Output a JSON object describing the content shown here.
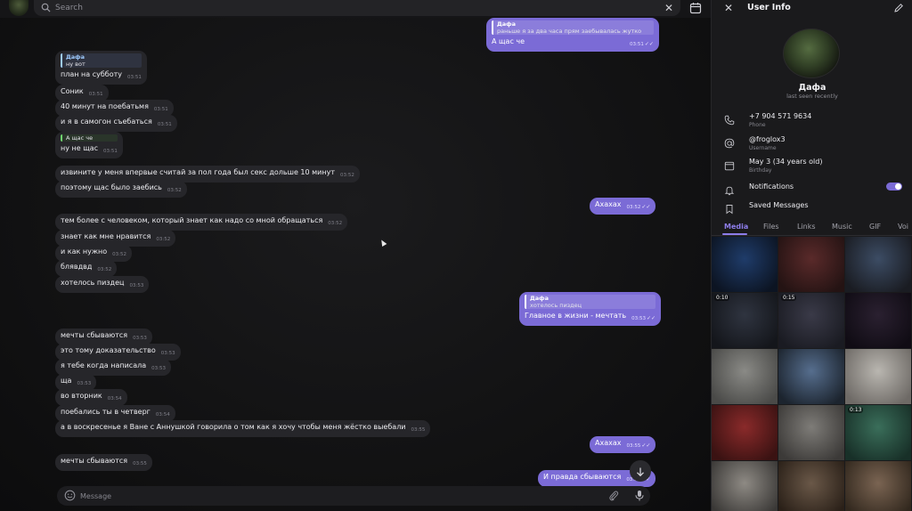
{
  "header": {
    "search_placeholder": "Search"
  },
  "messages": [
    {
      "id": "m0",
      "dir": "out",
      "reply_text": "раньше я за два часа прям заебывалась жутко",
      "reply_name": "Дафа",
      "text": "А щас че",
      "time": "03:51",
      "read": true
    },
    {
      "id": "m1",
      "dir": "in",
      "reply_name": "Дафа",
      "reply_text": "ну вот",
      "text": "план на субботу",
      "time": "03:51"
    },
    {
      "id": "m2",
      "dir": "in",
      "text": "Соник",
      "time": "03:51"
    },
    {
      "id": "m3",
      "dir": "in",
      "text": "40 минут на поебатьмя",
      "time": "03:51"
    },
    {
      "id": "m4",
      "dir": "in",
      "text": "и я в самогон съебаться",
      "time": "03:51"
    },
    {
      "id": "m5",
      "dir": "in",
      "reply_name": "",
      "reply_text": "А щас че",
      "text": "ну не щас",
      "time": "03:51"
    },
    {
      "id": "m6",
      "dir": "in",
      "text": "извините у меня впервые считай за пол года был секс дольше 10 минут",
      "time": "03:52"
    },
    {
      "id": "m7",
      "dir": "in",
      "text": "поэтому щас было заебись",
      "time": "03:52"
    },
    {
      "id": "m8",
      "dir": "out",
      "text": "Ахахах",
      "time": "03:52",
      "read": true
    },
    {
      "id": "m9",
      "dir": "in",
      "text": "тем более с человеком, который знает как надо со мной обращаться",
      "time": "03:52"
    },
    {
      "id": "m10",
      "dir": "in",
      "text": "знает как мне нравится",
      "time": "03:52"
    },
    {
      "id": "m11",
      "dir": "in",
      "text": "и как нужно",
      "time": "03:52"
    },
    {
      "id": "m12",
      "dir": "in",
      "text": "блявдвд",
      "time": "03:52"
    },
    {
      "id": "m13",
      "dir": "in",
      "text": "хотелось пиздец",
      "time": "03:53"
    },
    {
      "id": "m14",
      "dir": "out",
      "reply_name": "Дафа",
      "reply_text": "хотелось пиздец",
      "text": "Главное в жизни - мечтать",
      "time": "03:53",
      "read": true
    },
    {
      "id": "m15",
      "dir": "in",
      "text": "мечты сбываются",
      "time": "03:53"
    },
    {
      "id": "m16",
      "dir": "in",
      "text": "это тому доказательство",
      "time": "03:53"
    },
    {
      "id": "m17",
      "dir": "in",
      "text": "я тебе когда написала",
      "time": "03:53"
    },
    {
      "id": "m18",
      "dir": "in",
      "text": "ща",
      "time": "03:53"
    },
    {
      "id": "m19",
      "dir": "in",
      "text": "во вторник",
      "time": "03:54"
    },
    {
      "id": "m20",
      "dir": "in",
      "text": "поебались ты в четверг",
      "time": "03:54"
    },
    {
      "id": "m21",
      "dir": "in",
      "text": "а в воскресенье я Ване с Аннушкой говорила о том как я хочу чтобы меня жёстко выебали",
      "time": "03:55"
    },
    {
      "id": "m22",
      "dir": "out",
      "text": "Ахахах",
      "time": "03:55",
      "read": true
    },
    {
      "id": "m23",
      "dir": "in",
      "text": "мечты сбываются",
      "time": "03:55"
    },
    {
      "id": "m24",
      "dir": "out",
      "text": "И правда сбываются",
      "time": "03:55",
      "read": true
    }
  ],
  "composer": {
    "placeholder": "Message"
  },
  "panel": {
    "title": "User Info",
    "name": "Дафа",
    "status": "last seen recently",
    "phone": "+7 904 571 9634",
    "phone_label": "Phone",
    "username": "@froglox3",
    "username_label": "Username",
    "birthday": "May 3 (34 years old)",
    "birthday_label": "Birthday",
    "notifications_label": "Notifications",
    "notifications_on": true,
    "saved_label": "Saved Messages",
    "tabs": [
      "Media",
      "Files",
      "Links",
      "Music",
      "GIF",
      "Voi"
    ],
    "active_tab": "Media",
    "media": [
      {
        "tone": [
          "#1f3c6a",
          "#0c1422"
        ],
        "duration": ""
      },
      {
        "tone": [
          "#5a2a2a",
          "#241313"
        ],
        "duration": ""
      },
      {
        "tone": [
          "#3c4c64",
          "#1a1c22"
        ],
        "duration": ""
      },
      {
        "tone": [
          "#2f3440",
          "#14161b"
        ],
        "duration": "0:10"
      },
      {
        "tone": [
          "#3a3a48",
          "#1a1b22"
        ],
        "duration": "0:15"
      },
      {
        "tone": [
          "#2a2030",
          "#100c14"
        ],
        "duration": ""
      },
      {
        "tone": [
          "#8a8a86",
          "#4a4a48"
        ],
        "duration": ""
      },
      {
        "tone": [
          "#566e8e",
          "#1c242e"
        ],
        "duration": ""
      },
      {
        "tone": [
          "#b9b6b0",
          "#6e6a66"
        ],
        "duration": ""
      },
      {
        "tone": [
          "#8a2a2a",
          "#3a1212"
        ],
        "duration": ""
      },
      {
        "tone": [
          "#7e7c78",
          "#3c3a38"
        ],
        "duration": ""
      },
      {
        "tone": [
          "#3a6e5a",
          "#183028"
        ],
        "duration": "0:13"
      },
      {
        "tone": [
          "#8e8a84",
          "#3a3836"
        ],
        "duration": ""
      },
      {
        "tone": [
          "#6a5848",
          "#2a2018"
        ],
        "duration": ""
      },
      {
        "tone": [
          "#7a6452",
          "#32281e"
        ],
        "duration": ""
      }
    ]
  }
}
